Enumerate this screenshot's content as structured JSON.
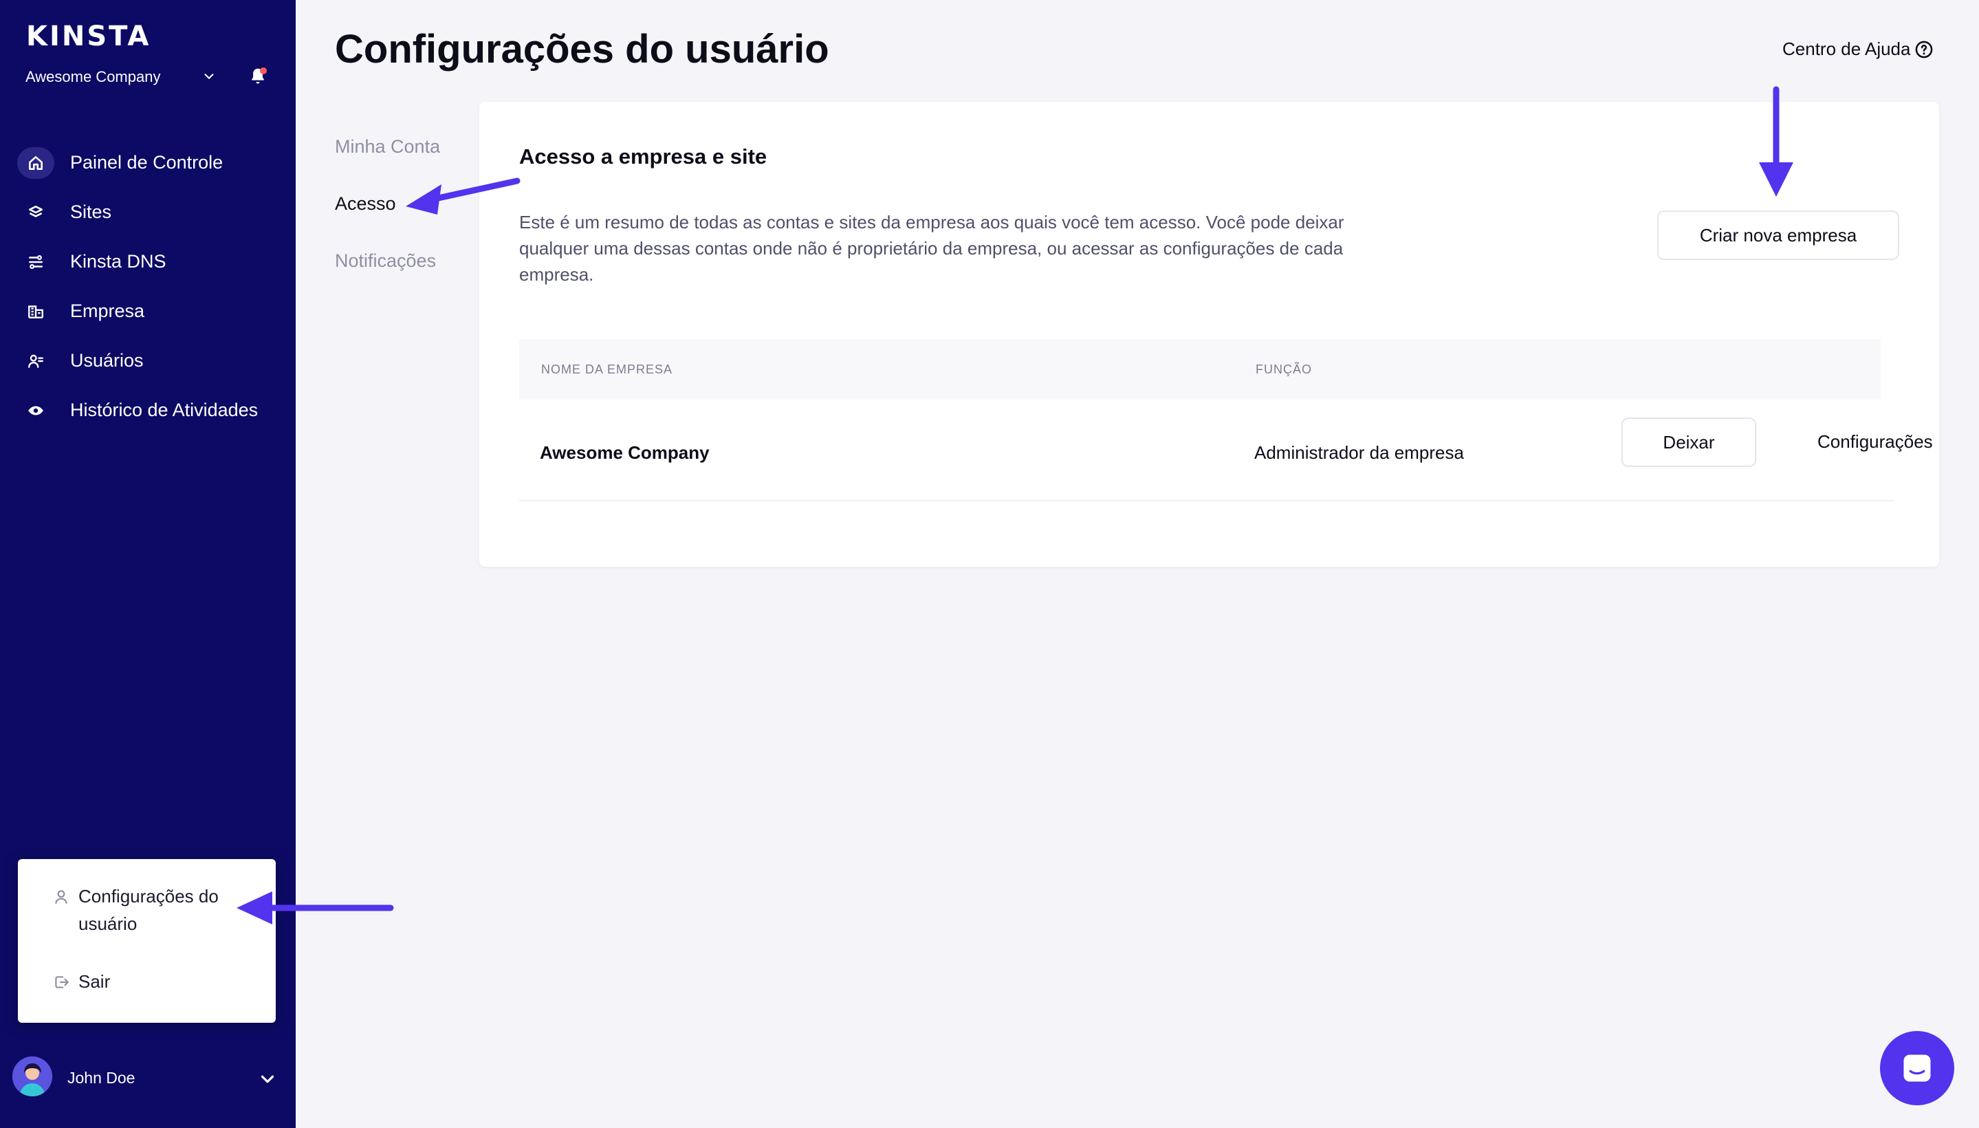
{
  "brand": {
    "logo_text": "KINSTA",
    "company_name": "Awesome Company"
  },
  "nav": {
    "items": [
      {
        "label": "Painel de Controle",
        "icon": "home-icon"
      },
      {
        "label": "Sites",
        "icon": "layers-icon"
      },
      {
        "label": "Kinsta DNS",
        "icon": "dns-icon"
      },
      {
        "label": "Empresa",
        "icon": "building-icon"
      },
      {
        "label": "Usuários",
        "icon": "users-icon"
      },
      {
        "label": "Histórico de Atividades",
        "icon": "eye-icon"
      }
    ]
  },
  "user_menu": {
    "settings_label": "Configurações do usuário",
    "logout_label": "Sair",
    "user_name": "John Doe"
  },
  "header": {
    "title": "Configurações do usuário",
    "help_label": "Centro de Ajuda"
  },
  "subnav": {
    "items": [
      "Minha Conta",
      "Acesso",
      "Notificações"
    ],
    "active": "Acesso"
  },
  "card": {
    "title": "Acesso a empresa e site",
    "description": "Este é um resumo de todas as contas e sites da empresa aos quais você tem acesso. Você pode deixar qualquer uma dessas contas onde não é proprietário da empresa, ou acessar as configurações de cada empresa.",
    "create_button": "Criar nova empresa",
    "table": {
      "headers": [
        "NOME DA EMPRESA",
        "FUNÇÃO"
      ],
      "rows": [
        {
          "company": "Awesome Company",
          "role": "Administrador da empresa",
          "leave_label": "Deixar",
          "settings_label": "Configurações"
        }
      ]
    }
  },
  "colors": {
    "sidebar_bg": "#0c0a64",
    "accent": "#5333ed",
    "annotation_arrow": "#5333ed",
    "page_bg": "#f5f5f9"
  }
}
